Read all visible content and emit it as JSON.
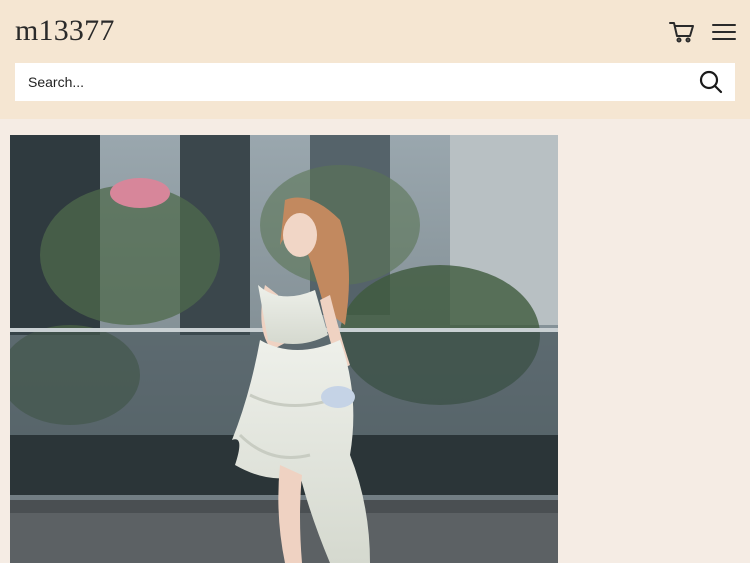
{
  "header": {
    "logo": "m13377",
    "icons": {
      "cart": "cart-icon",
      "menu": "hamburger-menu-icon"
    }
  },
  "search": {
    "placeholder": "Search...",
    "icon": "search-icon"
  },
  "colors": {
    "header_bg": "#f5e6d2",
    "page_bg": "#f5ece4",
    "text": "#2a2a2a"
  }
}
